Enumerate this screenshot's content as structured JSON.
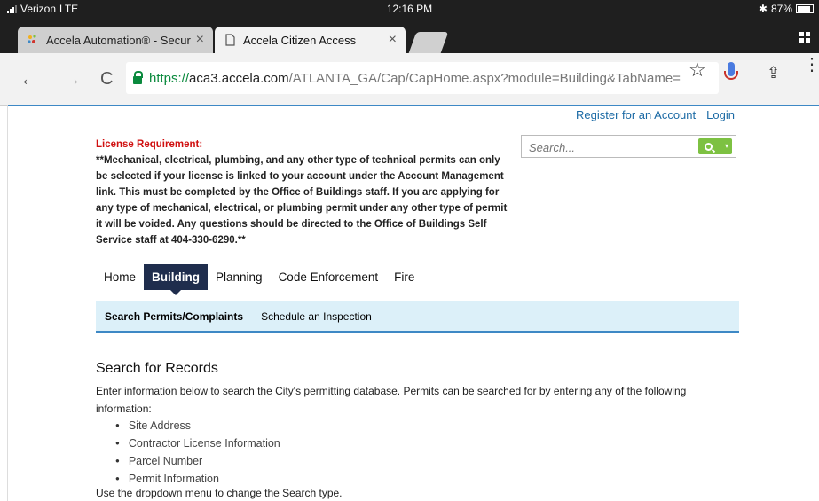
{
  "status_bar": {
    "carrier": "Verizon",
    "network": "LTE",
    "time": "12:16 PM",
    "bluetooth": "✱",
    "battery": "87%"
  },
  "tabs": [
    {
      "title": "Accela Automation® - Secur",
      "close": "×"
    },
    {
      "title": "Accela Citizen Access",
      "close": "×"
    }
  ],
  "toolbar": {
    "back": "←",
    "forward": "→",
    "reload": "C",
    "url_scheme": "https://",
    "url_domain": "aca3.accela.com",
    "url_path": "/ATLANTA_GA/Cap/CapHome.aspx?module=Building&TabName=",
    "star": "☆",
    "share": "⇪",
    "more": "⋮"
  },
  "header": {
    "register_link": "Register for an Account",
    "login_link": "Login"
  },
  "license": {
    "title": "License Requirement:",
    "body": "**Mechanical, electrical, plumbing, and any other type of technical permits can only be selected if your license is linked to your account under the Account Management link. This must be completed by the Office of Buildings staff. If you are applying for any type of mechanical, electrical, or plumbing permit under any other type of permit it will be voided.  Any questions should be directed to the Office of Buildings Self Service staff at 404-330-6290.**"
  },
  "search": {
    "placeholder": "Search...",
    "caret": "▾"
  },
  "main_nav": [
    "Home",
    "Building",
    "Planning",
    "Code Enforcement",
    "Fire"
  ],
  "sub_nav": [
    "Search Permits/Complaints",
    "Schedule an Inspection"
  ],
  "content": {
    "title": "Search for Records",
    "description": "Enter information below to search the City's permitting database. Permits can be searched for by entering any of the following information:",
    "items": [
      "Site Address",
      "Contractor License Information",
      "Parcel Number",
      "Permit Information"
    ],
    "dropdown_note": "Use the dropdown menu to change the Search type."
  }
}
